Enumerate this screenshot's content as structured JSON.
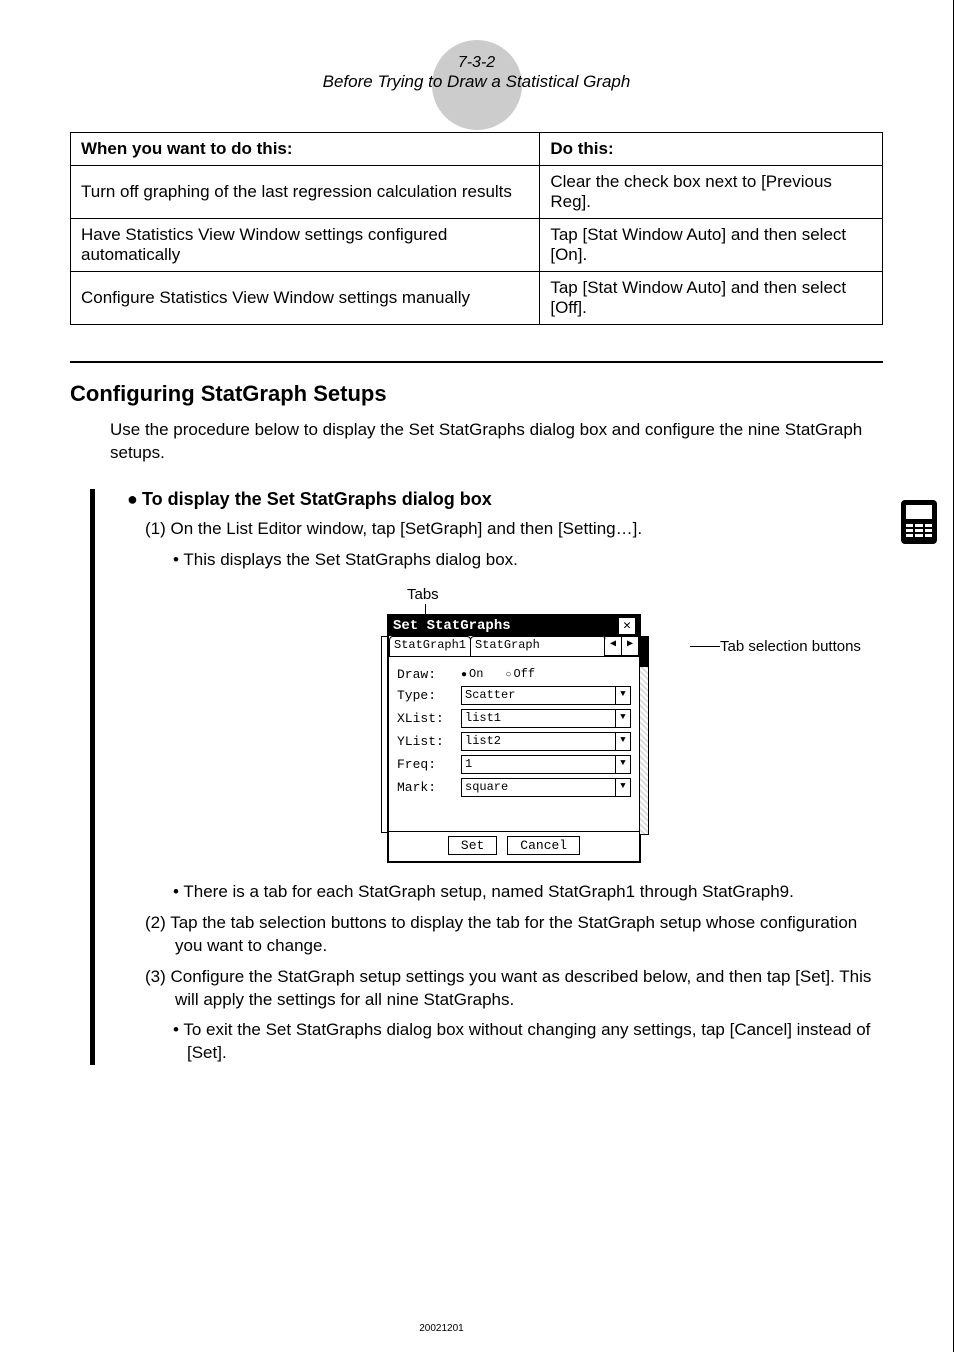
{
  "header": {
    "page_ref": "7-3-2",
    "page_title": "Before Trying to Draw a Statistical Graph"
  },
  "table": {
    "headers": [
      "When you want to do this:",
      "Do this:"
    ],
    "rows": [
      [
        "Turn off graphing of the last regression calculation results",
        "Clear the check box next to [Previous Reg]."
      ],
      [
        "Have Statistics View Window settings configured automatically",
        "Tap [Stat Window Auto] and then select [On]."
      ],
      [
        "Configure Statistics View Window settings manually",
        "Tap [Stat Window Auto] and then select [Off]."
      ]
    ]
  },
  "section_heading": "Configuring StatGraph Setups",
  "section_intro": "Use the procedure below to display the Set StatGraphs dialog box and configure the nine StatGraph setups.",
  "sub_heading": "To display the Set StatGraphs dialog box",
  "step1": "(1) On the List Editor window, tap [SetGraph] and then [Setting…].",
  "step1_sub": "• This displays the Set StatGraphs dialog box.",
  "labels": {
    "tabs": "Tabs",
    "tab_selection": "Tab selection buttons"
  },
  "dialog": {
    "title": "Set StatGraphs",
    "tab1": "StatGraph1",
    "tab2": "StatGraph",
    "rows": {
      "draw_label": "Draw:",
      "draw_on": "On",
      "draw_off": "Off",
      "type_label": "Type:",
      "type_val": "Scatter",
      "xlist_label": "XList:",
      "xlist_val": "list1",
      "ylist_label": "YList:",
      "ylist_val": "list2",
      "freq_label": "Freq:",
      "freq_val": "1",
      "mark_label": "Mark:",
      "mark_val": "square"
    },
    "set_btn": "Set",
    "cancel_btn": "Cancel"
  },
  "step1_sub2": "• There is a tab for each StatGraph setup, named StatGraph1 through StatGraph9.",
  "step2": "(2) Tap the tab selection buttons to display the tab for the StatGraph setup whose configuration you want to change.",
  "step3": "(3) Configure the StatGraph setup settings you want as described below, and then tap [Set]. This will apply the settings for all nine StatGraphs.",
  "step3_sub": "• To exit the Set StatGraphs dialog box without changing any settings, tap [Cancel] instead of [Set].",
  "footer": "20021201"
}
